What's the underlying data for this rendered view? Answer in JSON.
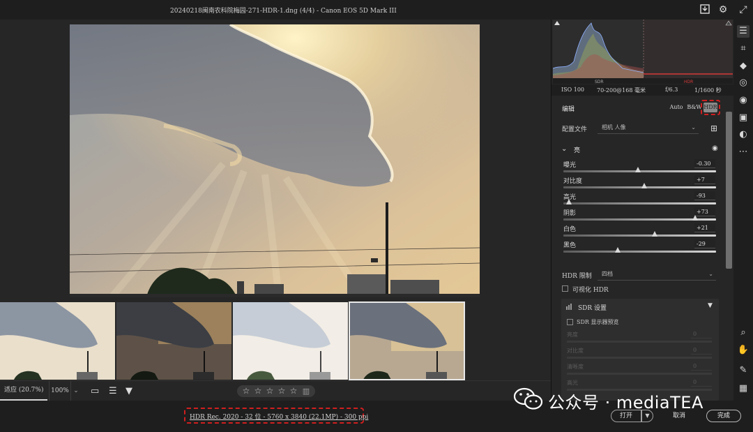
{
  "window": {
    "title": "20240218闽南农科院梅园-271-HDR-1.dng (4/4) -  Canon EOS 5D Mark III",
    "export_icon": "download-icon",
    "settings_icon": "gear-icon",
    "expand_icon": "expand-arrows-icon"
  },
  "photo": {
    "description_icon": "hdr-sunset-photo"
  },
  "filmstrip": {
    "thumbnails": [
      {
        "tone": "bright",
        "selected": false
      },
      {
        "tone": "dark",
        "selected": false
      },
      {
        "tone": "overexposed",
        "selected": false
      },
      {
        "tone": "normal",
        "selected": true
      }
    ]
  },
  "bottombar": {
    "zoom_label": "适应 (20.7%)",
    "zoom_percent": "100%",
    "zoom_dropdown_icon": "chevron-down-icon",
    "filmstrip_icon": "filmstrip-icon",
    "sort_icon": "sort-icon",
    "filter_icon": "filter-icon",
    "stars": [
      "☆",
      "☆",
      "☆",
      "☆",
      "☆"
    ],
    "trash_icon": "trash-icon"
  },
  "footer": {
    "file_info": "HDR Rec. 2020 - 32 位 - 5760 x 3840 (22.1MP) - 300 ppi",
    "open_label": "打开",
    "open_dropdown_icon": "chevron-down-icon",
    "cancel_label": "取消",
    "done_label": "完成"
  },
  "watermark": {
    "text": "公众号 · mediaTEA",
    "icon": "wechat-icon"
  },
  "histogram": {
    "sdr_label": "SDR",
    "hdr_label": "HDR",
    "clip_shadow_icon": "triangle-clip-icon",
    "clip_highlight_icon": "triangle-clip-icon"
  },
  "metadata": {
    "iso": "ISO 100",
    "lens": "70-200@168 毫米",
    "aperture": "f/6.3",
    "shutter": "1/1600 秒"
  },
  "edit": {
    "title": "编辑",
    "auto_label": "Auto",
    "bw_label": "B&W",
    "hdr_label": "HDR",
    "profile_label": "配置文件",
    "profile_value": "相机 人像",
    "profile_browser_icon": "grid-browse-icon",
    "light_section": "亮",
    "visibility_icon": "eye-icon",
    "collapse_icon": "chevron-down-icon"
  },
  "sliders": [
    {
      "label": "曝光",
      "value": "-0.30",
      "pos": 0.49,
      "track": "gray"
    },
    {
      "label": "对比度",
      "value": "+7",
      "pos": 0.53,
      "track": "gray"
    },
    {
      "label": "高光",
      "value": "-93",
      "pos": 0.035,
      "track": "gray"
    },
    {
      "label": "阴影",
      "value": "+73",
      "pos": 0.865,
      "track": "gray"
    },
    {
      "label": "白色",
      "value": "+21",
      "pos": 0.6,
      "track": "gray"
    },
    {
      "label": "黑色",
      "value": "-29",
      "pos": 0.355,
      "track": "gray"
    }
  ],
  "hdr": {
    "limit_label": "HDR 限制",
    "limit_value": "四档",
    "visualize_label": "可视化 HDR",
    "sdr_settings_label": "SDR 设置",
    "sdr_icon": "bar-chart-icon",
    "sdr_collapse_icon": "triangle-down-icon",
    "sdr_preview_label": "SDR 显示器预览",
    "sdr_sliders": [
      {
        "label": "亮度",
        "value": "0"
      },
      {
        "label": "对比度",
        "value": "0"
      },
      {
        "label": "清晰度",
        "value": "0"
      },
      {
        "label": "高光",
        "value": "0"
      }
    ]
  },
  "tools": [
    {
      "name": "edit-sliders-icon",
      "glyph": "☰",
      "active": true
    },
    {
      "name": "crop-icon",
      "glyph": "⌗",
      "active": false
    },
    {
      "name": "eraser-icon",
      "glyph": "◆",
      "active": false
    },
    {
      "name": "masking-icon",
      "glyph": "◎",
      "active": false
    },
    {
      "name": "redeye-icon",
      "glyph": "◉",
      "active": false
    },
    {
      "name": "presets-icon",
      "glyph": "▣",
      "active": false
    },
    {
      "name": "snapshots-icon",
      "glyph": "◐",
      "active": false
    },
    {
      "name": "more-icon",
      "glyph": "⋯",
      "active": false
    },
    {
      "name": "zoom-icon",
      "glyph": "⌕",
      "active": false
    },
    {
      "name": "hand-icon",
      "glyph": "✋",
      "active": false
    },
    {
      "name": "eyedropper-icon",
      "glyph": "✎",
      "active": false
    },
    {
      "name": "grid-icon",
      "glyph": "▦",
      "active": false
    }
  ]
}
